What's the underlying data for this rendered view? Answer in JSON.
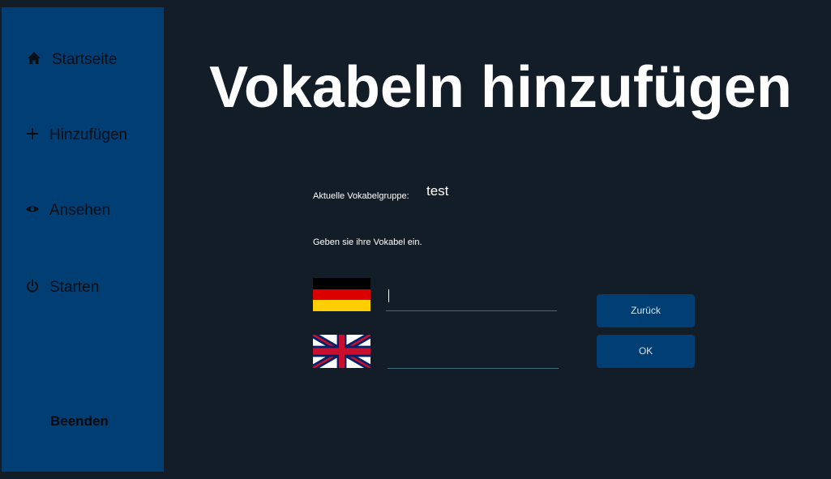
{
  "sidebar": {
    "items": [
      {
        "label": "Startseite",
        "icon": "home-icon"
      },
      {
        "label": "Hinzufügen",
        "icon": "plus-icon"
      },
      {
        "label": "Ansehen",
        "icon": "eye-icon"
      },
      {
        "label": "Starten",
        "icon": "power-icon"
      }
    ],
    "quit_label": "Beenden"
  },
  "main": {
    "title": "Vokabeln hinzufügen",
    "group_label": "Aktuelle Vokabelgruppe:",
    "group_value": "test",
    "instruction": "Geben sie ihre Vokabel ein.",
    "german_field": {
      "value": "",
      "flag": "german-flag-icon"
    },
    "english_field": {
      "value": "",
      "flag": "uk-flag-icon"
    },
    "back_button": "Zurück",
    "ok_button": "OK"
  },
  "colors": {
    "background": "#121d28",
    "sidebar": "#003e74",
    "button": "#003e74",
    "field_underline": "#3e6a7a",
    "title": "#ffffff"
  }
}
